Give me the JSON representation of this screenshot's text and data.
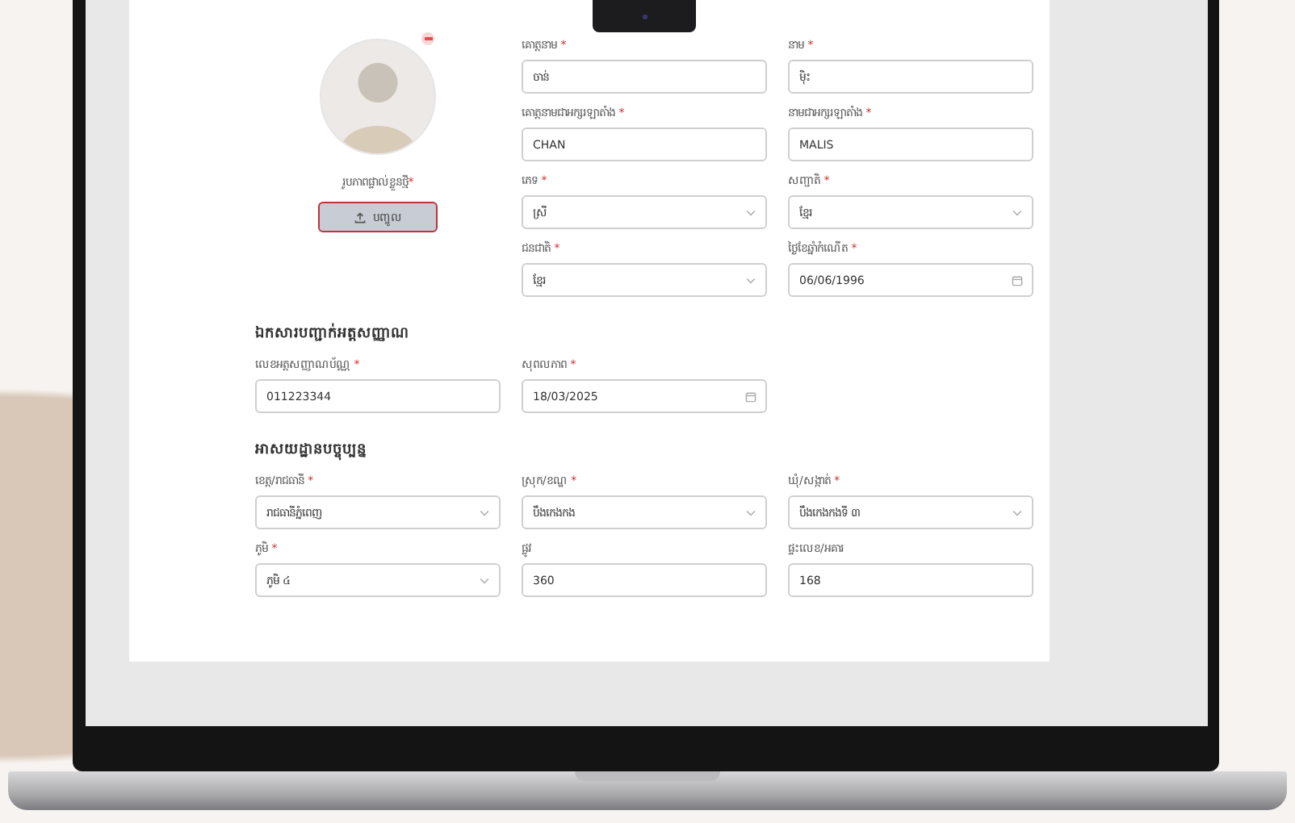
{
  "required_mark": "*",
  "profile": {
    "photo_label": "រូបភាពផ្ទាល់ខ្លួនថ្មី",
    "required": true,
    "upload_button": "បញ្ចូល"
  },
  "personal_fields": [
    {
      "label": "គោត្តនាម",
      "required": true,
      "kind": "text",
      "value": "ចាន់"
    },
    {
      "label": "នាម",
      "required": true,
      "kind": "text",
      "value": "ម៉ិះ"
    },
    {
      "label": "គោត្តនាមជាអក្សរឡាតាំង",
      "required": true,
      "kind": "text",
      "value": "CHAN"
    },
    {
      "label": "នាមជាអក្សរឡាតាំង",
      "required": true,
      "kind": "text",
      "value": "MALIS"
    },
    {
      "label": "ភេទ",
      "required": true,
      "kind": "select",
      "value": "ស្រី"
    },
    {
      "label": "សញ្ជាតិ",
      "required": true,
      "kind": "select",
      "value": "ខ្មែរ"
    },
    {
      "label": "ជនជាតិ",
      "required": true,
      "kind": "select",
      "value": "ខ្មែរ"
    },
    {
      "label": "ថ្ងៃខែឆ្នាំកំណើត",
      "required": true,
      "kind": "date",
      "value": "06/06/1996"
    }
  ],
  "sections": [
    {
      "title": "ឯកសារបញ្ជាក់អត្តសញ្ញាណ",
      "fields": [
        {
          "label": "លេខអត្តសញ្ញាណប័ណ្ណ",
          "required": true,
          "kind": "text",
          "value": "011223344"
        },
        {
          "label": "សុពលភាព",
          "required": true,
          "kind": "date",
          "value": "18/03/2025"
        }
      ]
    },
    {
      "title": "អាសយដ្ឋានបច្ចុប្បន្ន",
      "fields": [
        {
          "label": "ខេត្ត/រាជធានី",
          "required": true,
          "kind": "select",
          "value": "រាជធានីភ្នំពេញ"
        },
        {
          "label": "ស្រុក/ខណ្ឌ",
          "required": true,
          "kind": "select",
          "value": "បឹងកេងកង"
        },
        {
          "label": "ឃុំ/សង្កាត់",
          "required": true,
          "kind": "select",
          "value": "បឹងកេងកងទី ៣"
        },
        {
          "label": "ភូមិ",
          "required": true,
          "kind": "select",
          "value": "ភូមិ ៤"
        },
        {
          "label": "ផ្លូវ",
          "required": false,
          "kind": "text",
          "value": "360"
        },
        {
          "label": "ផ្ទះលេខ/អគារ",
          "required": false,
          "kind": "text",
          "value": "168"
        }
      ]
    }
  ]
}
